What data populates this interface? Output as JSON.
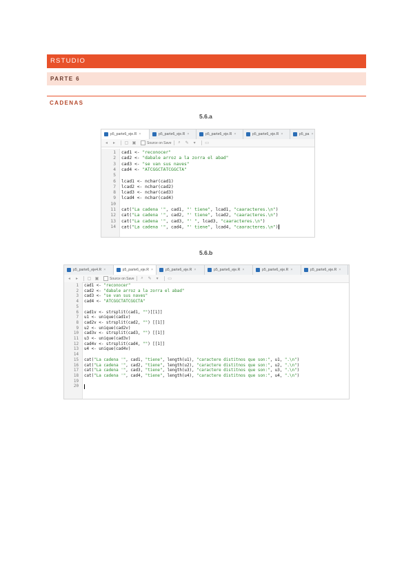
{
  "header": {
    "banner_title": "RSTUDIO",
    "part": "PARTE 6",
    "section": "CADENAS"
  },
  "figures": [
    {
      "caption": "5.6.a",
      "tabs": [
        "p5_parte6_eje.R",
        "p5_parte6_eje.R",
        "p5_parte6_eje.R",
        "p5_parte6_eje.R",
        "p5_pa"
      ],
      "active_tab": 0,
      "toolbar": {
        "source_on_save": "Source on Save"
      },
      "lines": [
        {
          "n": "1",
          "code": "cad1 <- \"reconocer\""
        },
        {
          "n": "2",
          "code": "cad2 <- \"dabale arroz a la zorra el abad\""
        },
        {
          "n": "3",
          "code": "cad3 <- \"se van sus naves\""
        },
        {
          "n": "4",
          "code": "cad4 <- \"ATCGGCTATCGGCTA\""
        },
        {
          "n": "5",
          "code": ""
        },
        {
          "n": "6",
          "code": "lcad1 <- nchar(cad1)"
        },
        {
          "n": "7",
          "code": "lcad2 <- nchar(cad2)"
        },
        {
          "n": "8",
          "code": "lcad3 <- nchar(cad3)"
        },
        {
          "n": "9",
          "code": "lcad4 <- nchar(cad4)"
        },
        {
          "n": "10",
          "code": ""
        },
        {
          "n": "11",
          "code": "cat(\"La cadena '\", cad1, \"' tiene\", lcad1, \"caaracteres.\\n\")"
        },
        {
          "n": "12",
          "code": "cat(\"La cadena '\", cad2, \"' tiene\", lcad2, \"caaracteres.\\n\")"
        },
        {
          "n": "13",
          "code": "cat(\"La cadena '\", cad3, \"' \", lcad3, \"caaracteres.\\n\")"
        },
        {
          "n": "14",
          "code": "cat(\"La cadena '\", cad4, \"' tiene\", lcad4, \"caaracteres.\\n\")"
        }
      ]
    },
    {
      "caption": "5.6.b",
      "tabs": [
        "p5_parte6_eje4.R",
        "p5_parte6_eje.R",
        "p5_parte6_eje.R",
        "p5_parte6_eje.R",
        "p5_parte6_eje.R",
        "p5_parte6_eje.R",
        "esPalindromo.R"
      ],
      "active_tab": 1,
      "toolbar": {
        "source_on_save": "Source on Save"
      },
      "lines": [
        {
          "n": "1",
          "code": "cad1 <- \"reconocer\""
        },
        {
          "n": "2",
          "code": "cad2 <- \"dabale arroz a la zorra el abad\""
        },
        {
          "n": "3",
          "code": "cad3 <- \"se van sus naves\""
        },
        {
          "n": "4",
          "code": "cad4 <- \"ATCGGCTATCGGCTA\""
        },
        {
          "n": "5",
          "code": ""
        },
        {
          "n": "6",
          "code": "cad1v <- strsplit(cad1, \"\")[[1]]"
        },
        {
          "n": "7",
          "code": "u1 <- unique(cad1v)"
        },
        {
          "n": "8",
          "code": "cad2v <- strsplit(cad2, \"\") [[1]]"
        },
        {
          "n": "9",
          "code": "u2 <- unique(cad2v)"
        },
        {
          "n": "10",
          "code": "cad3v <- strsplit(cad3, \"\") [[1]]"
        },
        {
          "n": "11",
          "code": "u3 <- unique(cad3v)"
        },
        {
          "n": "12",
          "code": "cad4v <- strsplit(cad4, \"\") [[1]]"
        },
        {
          "n": "13",
          "code": "u4 <- unique(cad4v)"
        },
        {
          "n": "14",
          "code": ""
        },
        {
          "n": "15",
          "code": "cat(\"La cadena '\", cad1, \"tiene\", length(u1), \"caractere distitnos que son:\", u1, \".\\n\")"
        },
        {
          "n": "16",
          "code": "cat(\"La cadena '\", cad2, \"tiene\", length(u2), \"caractere distitnos que son:\", u2, \".\\n\")"
        },
        {
          "n": "17",
          "code": "cat(\"La cadena '\", cad3, \"tiene\", length(u3), \"caractere distitnos que son:\", u3, \".\\n\")"
        },
        {
          "n": "18",
          "code": "cat(\"La cadena '\", cad4, \"tiene\", length(u4), \"caractere distitnos que son:\", u4, \".\\n\")"
        },
        {
          "n": "19",
          "code": ""
        },
        {
          "n": "20",
          "code": ""
        }
      ]
    }
  ],
  "colors": {
    "banner": "#e8512a",
    "subbanner": "#fbe0d6",
    "string": "#2e8b2e",
    "code": "#222222"
  }
}
